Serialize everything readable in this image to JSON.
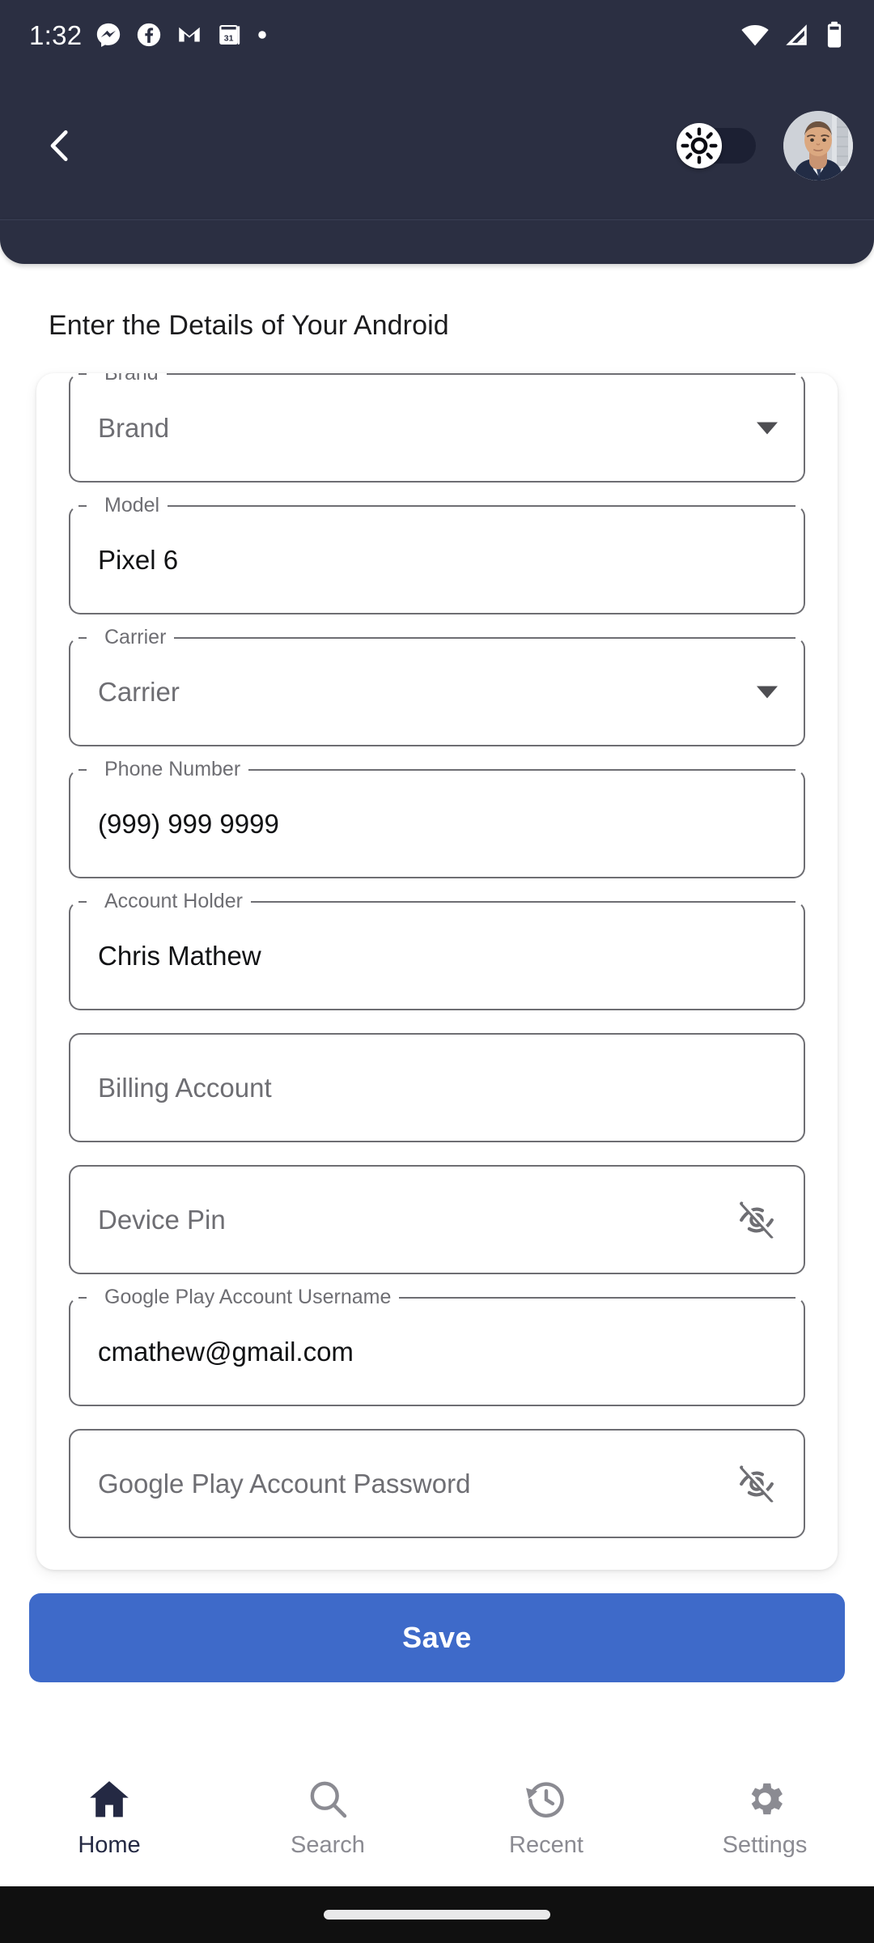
{
  "status_bar": {
    "time": "1:32",
    "left_icons": [
      "messenger-icon",
      "facebook-icon",
      "gmail-icon",
      "calendar-31-icon",
      "dot-icon"
    ],
    "right_icons": [
      "wifi-icon",
      "cellular-signal-icon",
      "battery-icon"
    ]
  },
  "app_bar": {
    "back_icon": "chevron-left-icon",
    "theme_toggle": {
      "icon": "sun-brightness-icon",
      "state": "off"
    },
    "avatar": "user-avatar"
  },
  "page": {
    "title": "Enter the Details of Your Android"
  },
  "form": {
    "fields": [
      {
        "name": "brand",
        "label": "Brand",
        "value": "Brand",
        "filled": false,
        "trailing": "dropdown-caret-icon"
      },
      {
        "name": "model",
        "label": "Model",
        "value": "Pixel 6",
        "filled": true,
        "trailing": ""
      },
      {
        "name": "carrier",
        "label": "Carrier",
        "value": "Carrier",
        "filled": false,
        "trailing": "dropdown-caret-icon"
      },
      {
        "name": "phone",
        "label": "Phone Number",
        "value": "(999) 999 9999",
        "filled": true,
        "trailing": ""
      },
      {
        "name": "holder",
        "label": "Account Holder",
        "value": "Chris Mathew",
        "filled": true,
        "trailing": ""
      },
      {
        "name": "billing",
        "label": "",
        "value": "Billing Account",
        "filled": false,
        "trailing": ""
      },
      {
        "name": "pin",
        "label": "",
        "value": "Device Pin",
        "filled": false,
        "trailing": "eye-off-icon"
      },
      {
        "name": "play-user",
        "label": "Google Play Account Username",
        "value": "cmathew@gmail.com",
        "filled": true,
        "trailing": ""
      },
      {
        "name": "play-pass",
        "label": "",
        "value": "Google Play Account Password",
        "filled": false,
        "trailing": "eye-off-icon"
      }
    ]
  },
  "actions": {
    "save_label": "Save",
    "save_color": "#3e6ac9"
  },
  "bottom_nav": {
    "items": [
      {
        "label": "Home",
        "icon": "home-icon",
        "active": true
      },
      {
        "label": "Search",
        "icon": "search-icon",
        "active": false
      },
      {
        "label": "Recent",
        "icon": "history-icon",
        "active": false
      },
      {
        "label": "Settings",
        "icon": "gear-icon",
        "active": false
      }
    ],
    "active_color": "#242943",
    "inactive_color": "#8b8b92"
  }
}
